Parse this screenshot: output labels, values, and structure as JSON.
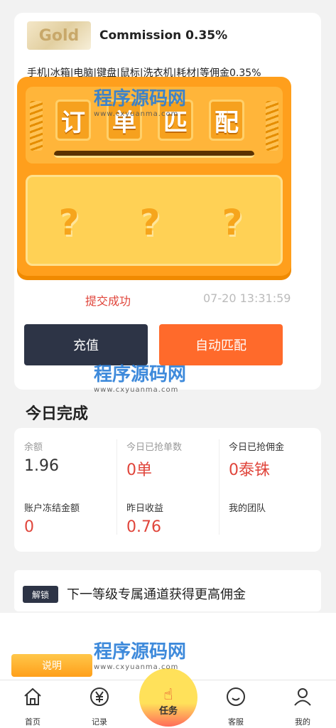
{
  "header": {
    "badge": "Gold",
    "commission": "Commission 0.35%",
    "categories": "手机|冰箱|电脑|键盘|鼠标|洗衣机|耗材|等佣金0.35%"
  },
  "machine": {
    "tiles": [
      "订",
      "单",
      "匹",
      "配"
    ],
    "slots": [
      "?",
      "?",
      "?"
    ]
  },
  "status": {
    "message": "提交成功",
    "time": "07-20 13:31:59"
  },
  "buttons": {
    "recharge": "充值",
    "auto_match": "自动匹配"
  },
  "today": {
    "title": "今日完成",
    "stats": [
      {
        "label": "余额",
        "value": "1.96"
      },
      {
        "label": "今日已抢单数",
        "value": "0单"
      },
      {
        "label": "今日已抢佣金",
        "value": "0泰铢"
      },
      {
        "label": "账户冻结金额",
        "value": "0"
      },
      {
        "label": "昨日收益",
        "value": "0.76"
      },
      {
        "label": "我的团队",
        "value": ""
      }
    ]
  },
  "unlock": {
    "tag": "解锁",
    "text": "下一等级专属通道获得更高佣金"
  },
  "explain": "说明",
  "tabs": [
    {
      "label": "首页",
      "icon": "home-icon"
    },
    {
      "label": "记录",
      "icon": "yen-icon"
    },
    {
      "label": "任务",
      "icon": "tap-icon"
    },
    {
      "label": "客服",
      "icon": "chat-icon"
    },
    {
      "label": "我的",
      "icon": "user-icon"
    }
  ],
  "watermark": {
    "main": "程序源码网",
    "sub": "www.cxyuanma.com"
  },
  "colors": {
    "primary_orange": "#ff6a2b",
    "dark_navy": "#2d3446",
    "red_value": "#e0453b"
  }
}
